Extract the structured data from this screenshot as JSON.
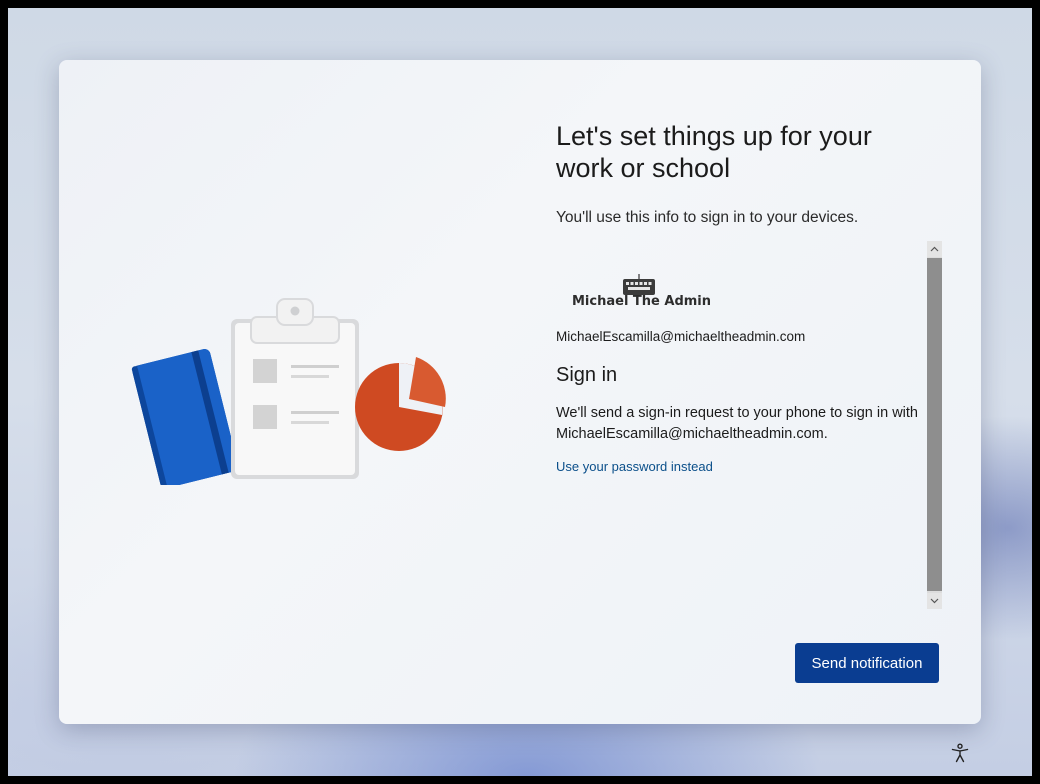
{
  "setup": {
    "title": "Let's set things up for your work or school",
    "subtitle": "You'll use this info to sign in to your devices.",
    "org_logo_text": "Michael The Admin",
    "account": "MichaelEscamilla@michaeltheadmin.com",
    "signin_heading": "Sign in",
    "signin_desc_line1": "We'll send a sign-in request to your phone to sign in with",
    "signin_desc_line2": "MichaelEscamilla@michaeltheadmin.com.",
    "password_link": "Use your password instead",
    "send_button": "Send notification"
  },
  "icons": {
    "illustration": "notebook-clipboard-piechart-illustration",
    "logo": "keyboard-icon",
    "scroll_up": "chevron-up-icon",
    "scroll_down": "chevron-down-icon",
    "accessibility": "accessibility-icon"
  },
  "colors": {
    "primary_button": "#0a3d91",
    "link": "#0b4f8a",
    "notebook": "#1565c0",
    "pie": "#d04a22"
  }
}
